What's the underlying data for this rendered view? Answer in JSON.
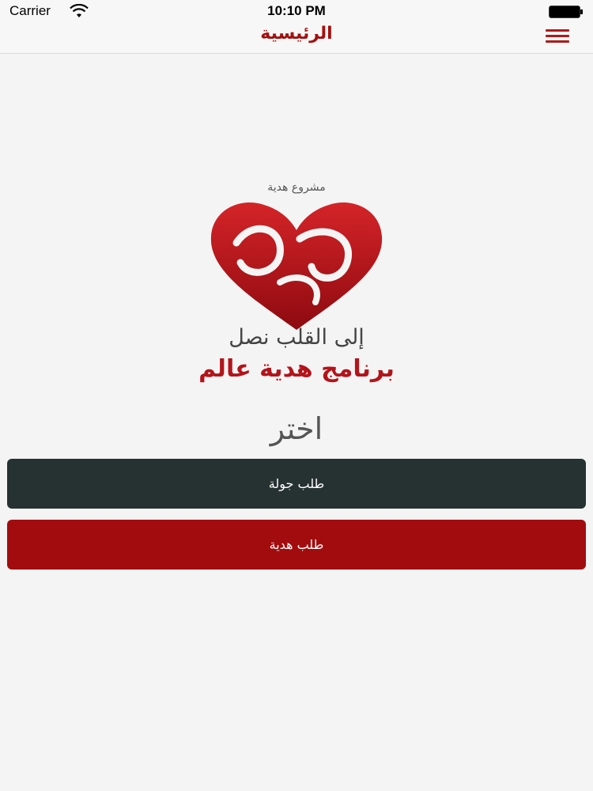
{
  "status_bar": {
    "carrier": "Carrier",
    "time": "10:10 PM",
    "wifi_icon": "wifi-icon",
    "battery_icon": "battery-icon"
  },
  "nav": {
    "title": "الرئيسية",
    "menu_icon": "hamburger-menu-icon"
  },
  "logo": {
    "project_label": "مشروع هدية",
    "logo_word": "هدية",
    "tagline": "إلى القلب نصل",
    "program": "برنامج هدية عالم"
  },
  "main": {
    "choose_label": "اختر",
    "buttons": [
      {
        "label": "طلب جولة"
      },
      {
        "label": "طلب هدية"
      }
    ]
  },
  "colors": {
    "accent": "#a50f0f",
    "dark_button": "#263231",
    "red_button": "#a30c0e",
    "background": "#f4f4f4"
  }
}
